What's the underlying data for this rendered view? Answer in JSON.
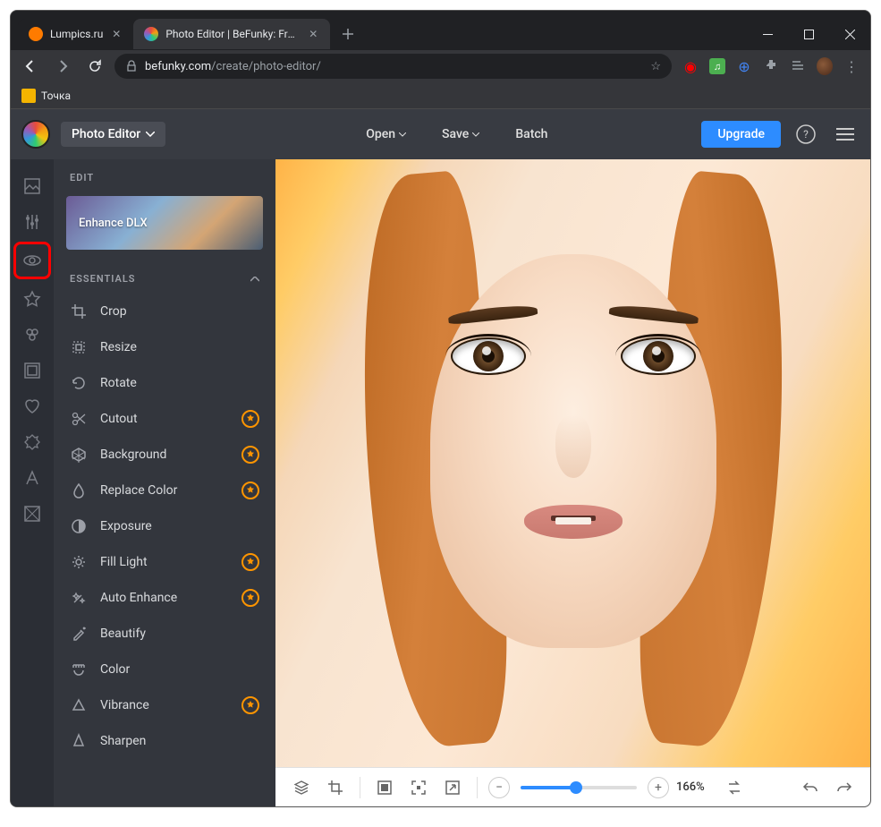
{
  "browser": {
    "tabs": [
      {
        "title": "Lumpics.ru",
        "favicon_color": "#ff7b00",
        "active": false
      },
      {
        "title": "Photo Editor | BeFunky: Free Onli",
        "favicon_mode": "rainbow",
        "active": true
      }
    ],
    "url_host": "befunky.com",
    "url_path": "/create/photo-editor/",
    "bookmark": "Точка"
  },
  "app": {
    "editor_dropdown": "Photo Editor",
    "open_label": "Open",
    "save_label": "Save",
    "batch_label": "Batch",
    "upgrade_label": "Upgrade"
  },
  "panel": {
    "title": "EDIT",
    "enhance_card": "Enhance DLX",
    "section": "ESSENTIALS",
    "tools": [
      {
        "icon": "crop",
        "label": "Crop",
        "premium": false
      },
      {
        "icon": "resize",
        "label": "Resize",
        "premium": false
      },
      {
        "icon": "rotate",
        "label": "Rotate",
        "premium": false
      },
      {
        "icon": "cutout",
        "label": "Cutout",
        "premium": true
      },
      {
        "icon": "background",
        "label": "Background",
        "premium": true
      },
      {
        "icon": "replacecolor",
        "label": "Replace Color",
        "premium": true
      },
      {
        "icon": "exposure",
        "label": "Exposure",
        "premium": false
      },
      {
        "icon": "filllight",
        "label": "Fill Light",
        "premium": true
      },
      {
        "icon": "autoenhance",
        "label": "Auto Enhance",
        "premium": true
      },
      {
        "icon": "beautify",
        "label": "Beautify",
        "premium": false
      },
      {
        "icon": "color",
        "label": "Color",
        "premium": false
      },
      {
        "icon": "vibrance",
        "label": "Vibrance",
        "premium": true
      },
      {
        "icon": "sharpen",
        "label": "Sharpen",
        "premium": false
      }
    ]
  },
  "canvas_toolbar": {
    "zoom_percent": "166%"
  }
}
